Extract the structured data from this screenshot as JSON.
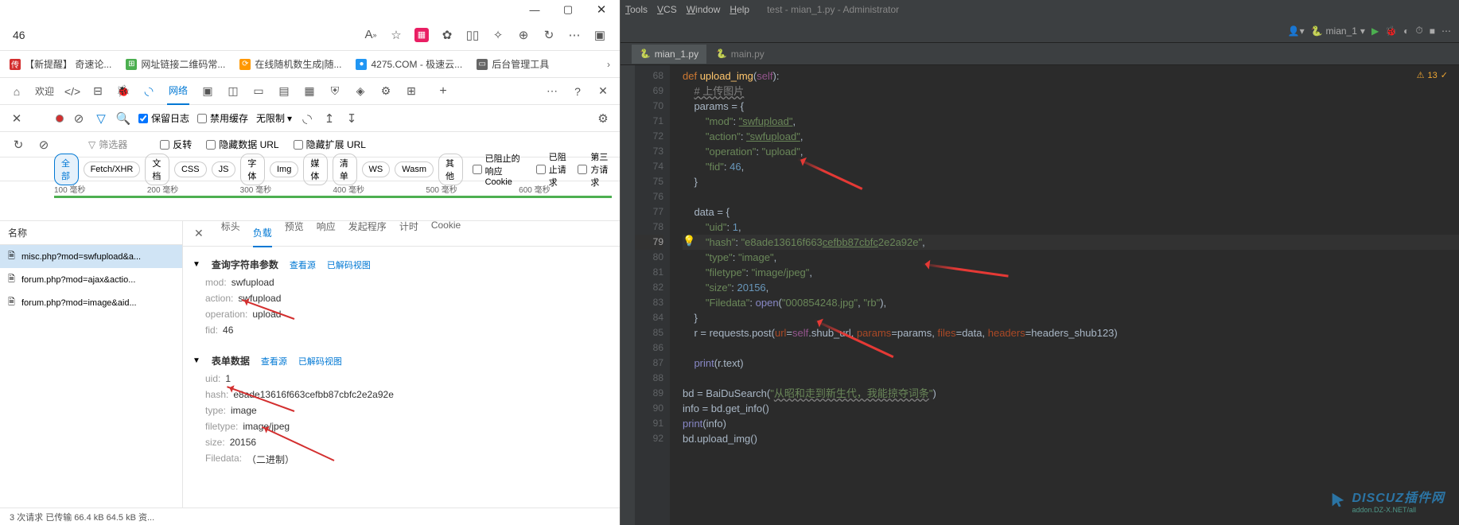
{
  "browser": {
    "addr": "46",
    "bookmarks": [
      {
        "icon": "传",
        "label": "【新提醒】 奇速论...",
        "icon_bg": "#d32f2f"
      },
      {
        "icon": "⊞",
        "label": "网址链接二维码常...",
        "icon_bg": "#4caf50"
      },
      {
        "icon": "⟳",
        "label": "在线随机数生成|随...",
        "icon_bg": "#ff9800"
      },
      {
        "icon": "●",
        "label": "4275.COM - 极速云...",
        "icon_bg": "#2196f3"
      },
      {
        "icon": "▭",
        "label": "后台管理工具",
        "icon_bg": "#666"
      }
    ],
    "toolbar_net": "网络",
    "filter": {
      "keep_log": "保留日志",
      "disable_cache": "禁用缓存",
      "no_limit": "无限制",
      "filter_placeholder": "筛选器",
      "invert": "反转",
      "hide_data_url": "隐藏数据 URL",
      "hide_ext_url": "隐藏扩展 URL"
    },
    "types": [
      "全部",
      "Fetch/XHR",
      "文档",
      "CSS",
      "JS",
      "字体",
      "Img",
      "媒体",
      "清单",
      "WS",
      "Wasm",
      "其他"
    ],
    "type_checks": [
      "已阻止的响应 Cookie",
      "已阻止请求",
      "第三方请求"
    ],
    "timeline": [
      "100 毫秒",
      "200 毫秒",
      "300 毫秒",
      "400 毫秒",
      "500 毫秒",
      "600 毫秒"
    ],
    "req_header": "名称",
    "requests": [
      {
        "name": "misc.php?mod=swfupload&a...",
        "sel": true
      },
      {
        "name": "forum.php?mod=ajax&actio...",
        "sel": false
      },
      {
        "name": "forum.php?mod=image&aid...",
        "sel": false
      }
    ],
    "detail_tabs": [
      "标头",
      "负载",
      "预览",
      "响应",
      "发起程序",
      "计时",
      "Cookie"
    ],
    "detail_active": "负载",
    "query_section": {
      "title": "查询字符串参数",
      "src": "查看源",
      "decoded": "已解码视图"
    },
    "query_kv": [
      {
        "k": "mod:",
        "v": "swfupload"
      },
      {
        "k": "action:",
        "v": "swfupload"
      },
      {
        "k": "operation:",
        "v": "upload"
      },
      {
        "k": "fid:",
        "v": "46"
      }
    ],
    "form_section": {
      "title": "表单数据",
      "src": "查看源",
      "decoded": "已解码视图"
    },
    "form_kv": [
      {
        "k": "uid:",
        "v": "1"
      },
      {
        "k": "hash:",
        "v": "e8ade13616f663cefbb87cbfc2e2a92e"
      },
      {
        "k": "type:",
        "v": "image"
      },
      {
        "k": "filetype:",
        "v": "image/jpeg"
      },
      {
        "k": "size:",
        "v": "20156"
      },
      {
        "k": "Filedata:",
        "v": "（二进制）"
      }
    ],
    "status": "3 次请求  已传输 66.4 kB  64.5 kB 资..."
  },
  "ide": {
    "menu": [
      "Tools",
      "VCS",
      "Window",
      "Help"
    ],
    "title": "test - mian_1.py - Administrator",
    "run_config": "mian_1",
    "warn_count": "13",
    "tabs": [
      {
        "name": "mian_1.py",
        "active": true
      },
      {
        "name": "main.py",
        "active": false
      }
    ],
    "lines": [
      {
        "n": 68,
        "html": "<span class='kw'>def </span><span class='fn'>upload_img</span>(<span class='self'>self</span>):"
      },
      {
        "n": 69,
        "html": "    <span class='comment cm-u'># 上传图片</span>"
      },
      {
        "n": 70,
        "html": "    params = {"
      },
      {
        "n": 71,
        "html": "        <span class='str'>\"mod\"</span>: <span class='str-u'>\"swfupload\"</span>,"
      },
      {
        "n": 72,
        "html": "        <span class='str'>\"action\"</span>: <span class='str-u'>\"swfupload\"</span>,"
      },
      {
        "n": 73,
        "html": "        <span class='str'>\"operation\"</span>: <span class='str'>\"upload\"</span>,"
      },
      {
        "n": 74,
        "html": "        <span class='str'>\"fid\"</span>: <span class='num'>46</span>,"
      },
      {
        "n": 75,
        "html": "    }"
      },
      {
        "n": 76,
        "html": ""
      },
      {
        "n": 77,
        "html": "    data = {"
      },
      {
        "n": 78,
        "html": "        <span class='str'>\"uid\"</span>: <span class='num'>1</span>,"
      },
      {
        "n": 79,
        "html": "        <span class='str'>\"hash\"</span>: <span class='str'>\"e8ade13616f663<span class='str-u'>cefbb87cbfc</span>2e2a92e\"</span>,",
        "hl": true
      },
      {
        "n": 80,
        "html": "        <span class='str'>\"type\"</span>: <span class='str'>\"image\"</span>,"
      },
      {
        "n": 81,
        "html": "        <span class='str'>\"filetype\"</span>: <span class='str'>\"image/jpeg\"</span>,"
      },
      {
        "n": 82,
        "html": "        <span class='str'>\"size\"</span>: <span class='num'>20156</span>,"
      },
      {
        "n": 83,
        "html": "        <span class='str'>\"Filedata\"</span>: <span class='builtin'>open</span>(<span class='str'>\"000854248.jpg\"</span>, <span class='str'>\"rb\"</span>),"
      },
      {
        "n": 84,
        "html": "    }"
      },
      {
        "n": 85,
        "html": "    r = requests.post(<span class='param'>url</span>=<span class='self'>self</span>.shub_url, <span class='param'>params</span>=params, <span class='param'>files</span>=data, <span class='param'>headers</span>=headers_shub123)"
      },
      {
        "n": 86,
        "html": ""
      },
      {
        "n": 87,
        "html": "    <span class='builtin'>print</span>(r.text)"
      },
      {
        "n": 88,
        "html": ""
      },
      {
        "n": 89,
        "html": "bd = BaiDuSearch(<span class='str'>\"<span class='cm-u'>从昭和走到新生代，我能掠夺词条</span>\"</span>)"
      },
      {
        "n": 90,
        "html": "info = bd.get_info()"
      },
      {
        "n": 91,
        "html": "<span class='builtin'>print</span>(info)"
      },
      {
        "n": 92,
        "html": "bd.upload_img()"
      }
    ],
    "watermark": "DISCUZ插件网",
    "watermark_sub": "addon.DZ-X.NET/all"
  }
}
